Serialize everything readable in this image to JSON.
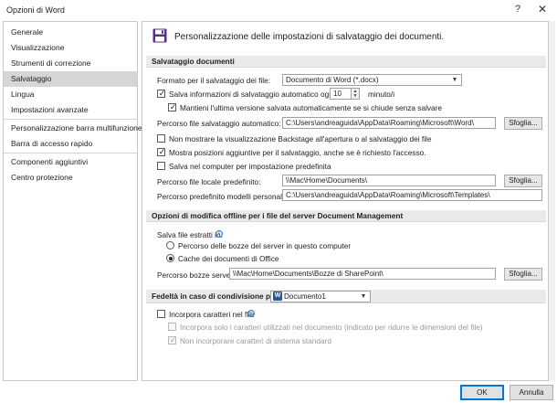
{
  "window": {
    "title": "Opzioni di Word",
    "help": "?",
    "close": "✕"
  },
  "sidebar": {
    "items": [
      {
        "label": "Generale"
      },
      {
        "label": "Visualizzazione"
      },
      {
        "label": "Strumenti di correzione"
      },
      {
        "label": "Salvataggio"
      },
      {
        "label": "Lingua"
      },
      {
        "label": "Impostazioni avanzate"
      },
      {
        "label": "Personalizzazione barra multifunzione"
      },
      {
        "label": "Barra di accesso rapido"
      },
      {
        "label": "Componenti aggiuntivi"
      },
      {
        "label": "Centro protezione"
      }
    ],
    "selected": "Salvataggio"
  },
  "header": {
    "text": "Personalizzazione delle impostazioni di salvataggio dei documenti.",
    "icon": "floppy-disk-icon"
  },
  "save_section": {
    "title": "Salvataggio documenti",
    "format_label": "Formato per il salvataggio dei file:",
    "format_value": "Documento di Word (*.docx)",
    "autorecover_label": "Salva informazioni di salvataggio automatico ogni",
    "autorecover_minutes": "10",
    "minutes_label": "minuto/i",
    "keep_last_label": "Mantieni l'ultima versione salvata automaticamente se si chiude senza salvare",
    "autorecover_path_label": "Percorso file salvataggio automatico:",
    "autorecover_path_value": "C:\\Users\\andreaguida\\AppData\\Roaming\\Microsoft\\Word\\",
    "browse_label": "Sfoglia...",
    "no_backstage_label": "Non mostrare la visualizzazione Backstage all'apertura o al salvataggio dei file",
    "show_locations_label": "Mostra posizioni aggiuntive per il salvataggio, anche se è richiesto l'accesso.",
    "save_to_computer_label": "Salva nel computer per impostazione predefinita",
    "default_local_label": "Percorso file locale predefinito:",
    "default_local_value": "\\\\Mac\\Home\\Documents\\",
    "templates_label": "Percorso predefinito modelli personali:",
    "templates_value": "C:\\Users\\andreaguida\\AppData\\Roaming\\Microsoft\\Templates\\"
  },
  "offline_section": {
    "title": "Opzioni di modifica offline per i file del server Document Management",
    "save_checked_out_label": "Salva file estratti in:",
    "radio_server_label": "Percorso delle bozze del server in questo computer",
    "radio_office_label": "Cache dei documenti di Office",
    "drafts_label": "Percorso bozze server:",
    "drafts_value": "\\\\Mac\\Home\\Documents\\Bozze di SharePoint\\",
    "browse_label": "Sfoglia..."
  },
  "fidelity_section": {
    "title": "Fedeltà in caso di condivisione per:",
    "document_value": "Documento1",
    "embed_fonts_label": "Incorpora caratteri nel file",
    "embed_only_used_label": "Incorpora solo i caratteri utilizzati nel documento (indicato per ridurre le dimensioni del file)",
    "no_system_fonts_label": "Non incorporare caratteri di sistema standard"
  },
  "footer": {
    "ok_label": "OK",
    "cancel_label": "Annulla"
  },
  "checkbox_mark": "✓",
  "radio_state": {
    "server": false,
    "office": true
  },
  "colors": {
    "accent": "#0078d7",
    "selected_bg": "#d6d6d6",
    "section_bg": "#eaeaea"
  }
}
